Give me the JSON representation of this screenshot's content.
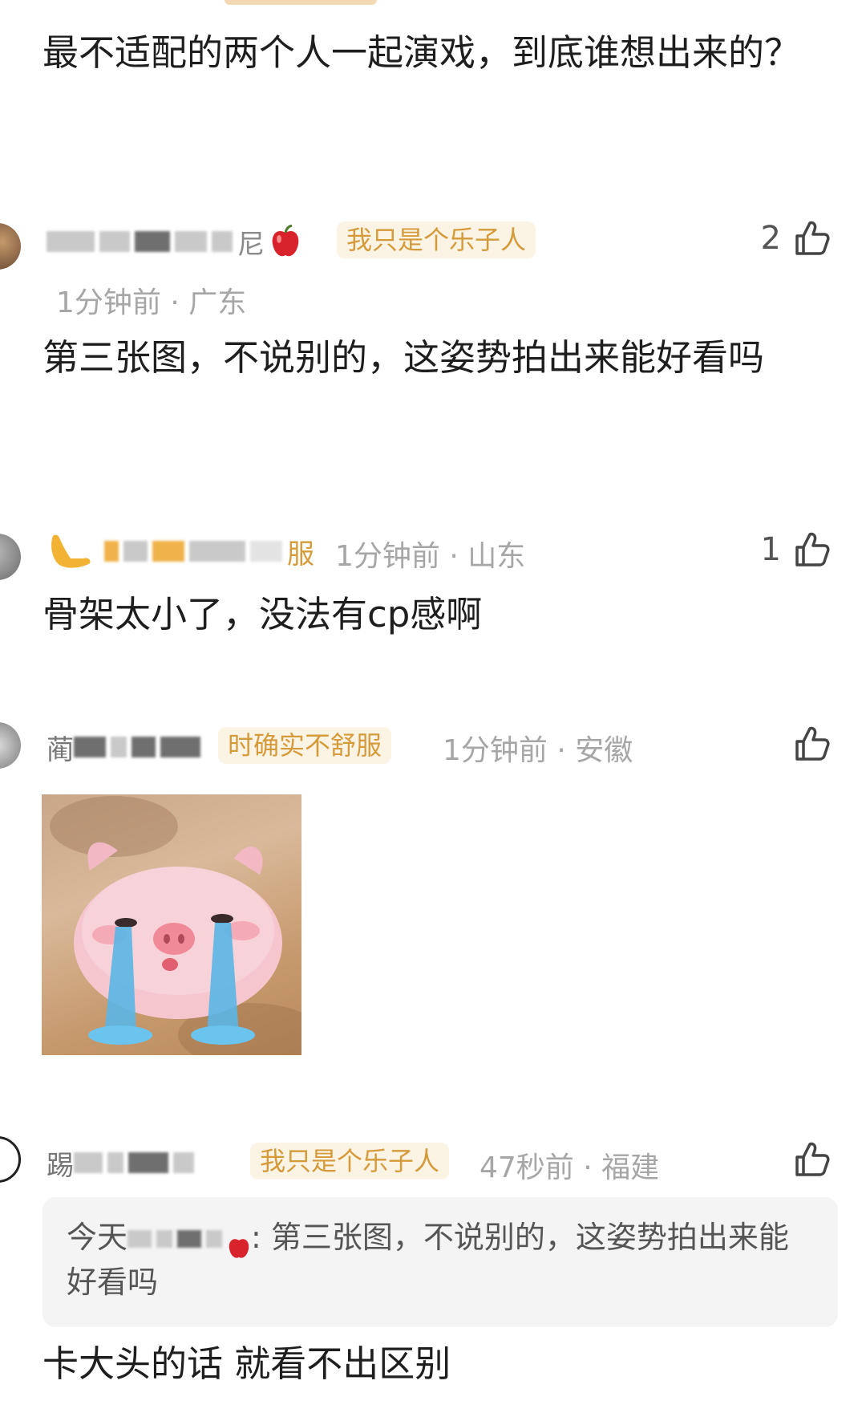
{
  "post": {
    "text": "最不适配的两个人一起演戏，到底谁想出来的？"
  },
  "comments": [
    {
      "name_visible": "尼",
      "badge": "我只是个乐子人",
      "time": "1分钟前",
      "region": "广东",
      "likes": "2",
      "text": "第三张图，不说别的，这姿势拍出来能好看吗"
    },
    {
      "name_visible": "服",
      "badge": "",
      "time": "1分钟前",
      "region": "山东",
      "likes": "1",
      "text": "骨架太小了，没法有cp感啊"
    },
    {
      "name_visible": "蔺",
      "badge": "时确实不舒服",
      "time": "1分钟前",
      "region": "安徽",
      "likes": "",
      "text": ""
    },
    {
      "name_visible": "踢",
      "badge": "我只是个乐子人",
      "time": "47秒前",
      "region": "福建",
      "likes": "",
      "quote_prefix": "今天",
      "quote_text": ": 第三张图，不说别的，这姿势拍出来能好看吗",
      "text": "卡大头的话 就看不出区别"
    }
  ],
  "separator": " · ",
  "icons": {
    "like": "thumbs-up-icon",
    "apple": "apple-icon",
    "hand": "pointing-hand-icon"
  },
  "colors": {
    "badge_bg": "#fbf4e4",
    "badge_text": "#d59a3a",
    "meta": "#a6a6a6"
  }
}
